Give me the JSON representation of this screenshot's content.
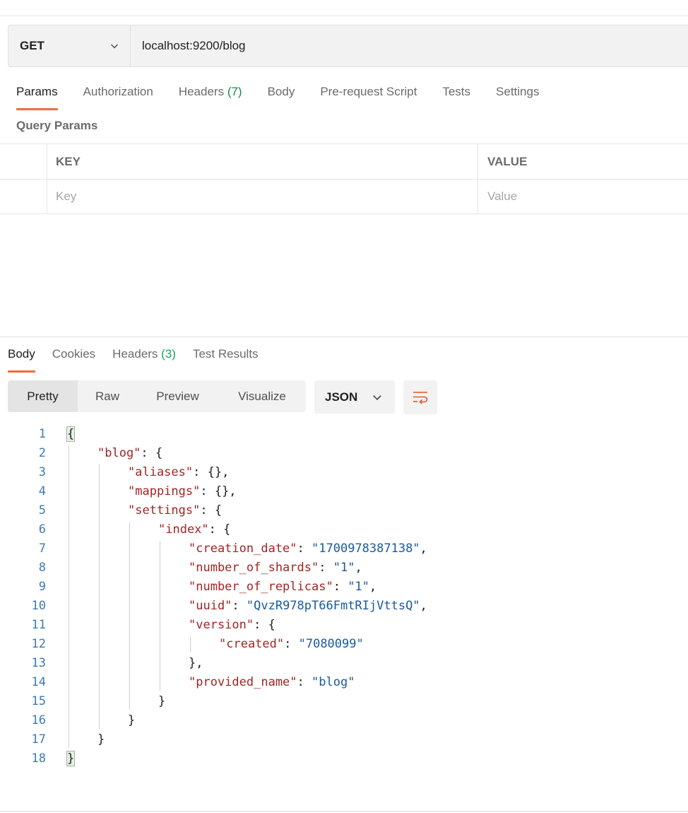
{
  "request": {
    "method": "GET",
    "url": "localhost:9200/blog"
  },
  "request_tabs": [
    {
      "label": "Params",
      "count": ""
    },
    {
      "label": "Authorization",
      "count": ""
    },
    {
      "label": "Headers",
      "count": "(7)"
    },
    {
      "label": "Body",
      "count": ""
    },
    {
      "label": "Pre-request Script",
      "count": ""
    },
    {
      "label": "Tests",
      "count": ""
    },
    {
      "label": "Settings",
      "count": ""
    }
  ],
  "query_params": {
    "title": "Query Params",
    "key_header": "KEY",
    "value_header": "VALUE",
    "key_placeholder": "Key",
    "value_placeholder": "Value"
  },
  "response_tabs": [
    {
      "label": "Body",
      "count": ""
    },
    {
      "label": "Cookies",
      "count": ""
    },
    {
      "label": "Headers",
      "count": "(3)"
    },
    {
      "label": "Test Results",
      "count": ""
    }
  ],
  "view_modes": [
    "Pretty",
    "Raw",
    "Preview",
    "Visualize"
  ],
  "format_select": "JSON",
  "colors": {
    "accent": "#f26b3a",
    "count_green": "#1ba35c",
    "json_key": "#a32424",
    "json_string": "#1a5a9c"
  },
  "code_lines": [
    {
      "n": "1",
      "indent": 0,
      "parts": [
        {
          "t": "{",
          "c": "brace"
        }
      ]
    },
    {
      "n": "2",
      "indent": 1,
      "parts": [
        {
          "t": "\"blog\"",
          "c": "k"
        },
        {
          "t": ": {",
          "c": "p"
        }
      ]
    },
    {
      "n": "3",
      "indent": 2,
      "parts": [
        {
          "t": "\"aliases\"",
          "c": "k"
        },
        {
          "t": ": {},",
          "c": "p"
        }
      ]
    },
    {
      "n": "4",
      "indent": 2,
      "parts": [
        {
          "t": "\"mappings\"",
          "c": "k"
        },
        {
          "t": ": {},",
          "c": "p"
        }
      ]
    },
    {
      "n": "5",
      "indent": 2,
      "parts": [
        {
          "t": "\"settings\"",
          "c": "k"
        },
        {
          "t": ": {",
          "c": "p"
        }
      ]
    },
    {
      "n": "6",
      "indent": 3,
      "parts": [
        {
          "t": "\"index\"",
          "c": "k"
        },
        {
          "t": ": {",
          "c": "p"
        }
      ]
    },
    {
      "n": "7",
      "indent": 4,
      "parts": [
        {
          "t": "\"creation_date\"",
          "c": "k"
        },
        {
          "t": ": ",
          "c": "p"
        },
        {
          "t": "\"1700978387138\"",
          "c": "s"
        },
        {
          "t": ",",
          "c": "p"
        }
      ]
    },
    {
      "n": "8",
      "indent": 4,
      "parts": [
        {
          "t": "\"number_of_shards\"",
          "c": "k"
        },
        {
          "t": ": ",
          "c": "p"
        },
        {
          "t": "\"1\"",
          "c": "s"
        },
        {
          "t": ",",
          "c": "p"
        }
      ]
    },
    {
      "n": "9",
      "indent": 4,
      "parts": [
        {
          "t": "\"number_of_replicas\"",
          "c": "k"
        },
        {
          "t": ": ",
          "c": "p"
        },
        {
          "t": "\"1\"",
          "c": "s"
        },
        {
          "t": ",",
          "c": "p"
        }
      ]
    },
    {
      "n": "10",
      "indent": 4,
      "parts": [
        {
          "t": "\"uuid\"",
          "c": "k"
        },
        {
          "t": ": ",
          "c": "p"
        },
        {
          "t": "\"QvzR978pT66FmtRIjVttsQ\"",
          "c": "s"
        },
        {
          "t": ",",
          "c": "p"
        }
      ]
    },
    {
      "n": "11",
      "indent": 4,
      "parts": [
        {
          "t": "\"version\"",
          "c": "k"
        },
        {
          "t": ": {",
          "c": "p"
        }
      ]
    },
    {
      "n": "12",
      "indent": 5,
      "parts": [
        {
          "t": "\"created\"",
          "c": "k"
        },
        {
          "t": ": ",
          "c": "p"
        },
        {
          "t": "\"7080099\"",
          "c": "s"
        }
      ]
    },
    {
      "n": "13",
      "indent": 4,
      "parts": [
        {
          "t": "},",
          "c": "p"
        }
      ]
    },
    {
      "n": "14",
      "indent": 4,
      "parts": [
        {
          "t": "\"provided_name\"",
          "c": "k"
        },
        {
          "t": ": ",
          "c": "p"
        },
        {
          "t": "\"blog\"",
          "c": "s"
        }
      ]
    },
    {
      "n": "15",
      "indent": 3,
      "parts": [
        {
          "t": "}",
          "c": "p"
        }
      ]
    },
    {
      "n": "16",
      "indent": 2,
      "parts": [
        {
          "t": "}",
          "c": "p"
        }
      ]
    },
    {
      "n": "17",
      "indent": 1,
      "parts": [
        {
          "t": "}",
          "c": "p"
        }
      ]
    },
    {
      "n": "18",
      "indent": 0,
      "parts": [
        {
          "t": "}",
          "c": "brace"
        }
      ]
    }
  ]
}
